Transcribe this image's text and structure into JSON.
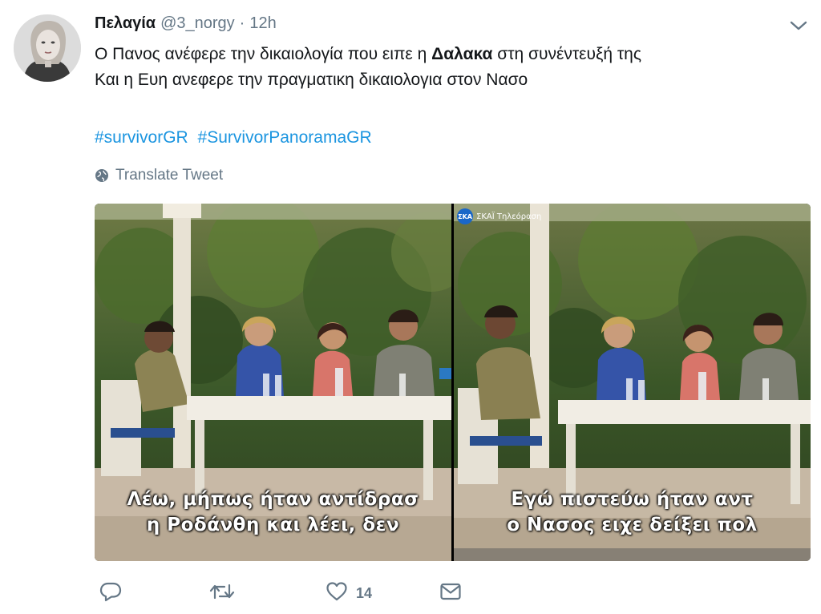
{
  "tweet": {
    "display_name": "Πελαγία",
    "handle": "@3_norgy",
    "separator": "·",
    "time": "12h",
    "text": {
      "line1_prefix": "Ο Πανος ανέφερε την δικαιολογία που ειπε η ",
      "line1_bold": "Δαλακα",
      "line1_suffix": " στη συνέντευξή της",
      "line2": "Και η Ευη ανεφερε την πραγματικη δικαιολογια στον Νασο"
    },
    "hashtags": [
      "#survivorGR",
      "#SurvivorPanoramaGR"
    ],
    "translate_label": "Translate Tweet",
    "media": {
      "left": {
        "subtitle_line1": "Λέω, μήπως ήταν αντίδρασ",
        "subtitle_line2": "η Ροδάνθη και λέει, δεν"
      },
      "right": {
        "watermark": "ΣΚΑΪ Τηλεόραση",
        "watermark_logo": "ΣΚΑ",
        "subtitle_line1": "Εγώ πιστεύω ήταν αντ",
        "subtitle_line2": "ο Νασος ειχε δείξει πολ"
      }
    },
    "actions": {
      "like_count": "14"
    }
  },
  "colors": {
    "link": "#1b95e0",
    "muted": "#657786",
    "text": "#14171a"
  }
}
